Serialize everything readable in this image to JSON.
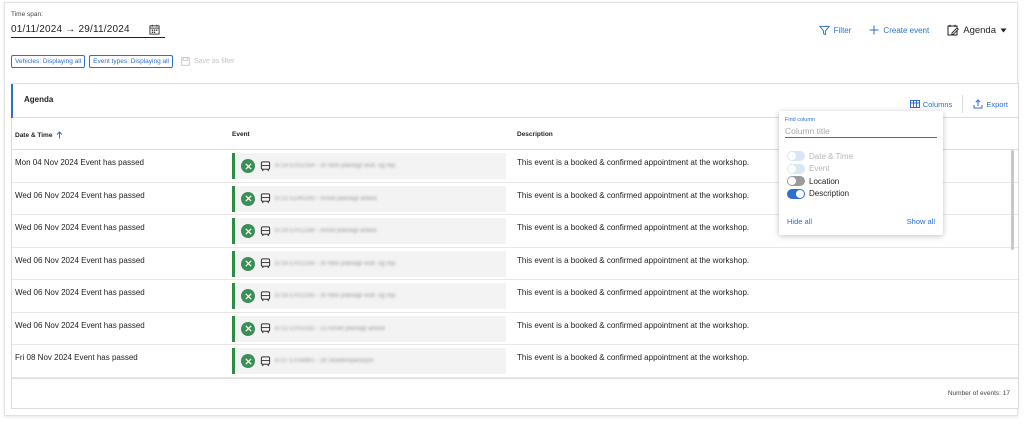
{
  "header": {
    "timespan_label": "Time span:",
    "timespan_value": "01/11/2024 → 29/11/2024",
    "calendar_icon": "calendar-icon"
  },
  "toolbar": {
    "filter_label": "Filter",
    "create_event_label": "Create event",
    "view_label": "Agenda"
  },
  "chips": {
    "vehicles": "Vehicles: Displaying all",
    "event_types": "Event types: Displaying all",
    "save_as_filter": "Save as filter"
  },
  "panel": {
    "title": "Agenda",
    "columns_label": "Columns",
    "export_label": "Export"
  },
  "table": {
    "headers": {
      "date_time": "Date & Time",
      "event": "Event",
      "description": "Description"
    },
    "rows": [
      {
        "date": "Mon 04 Nov 2024 Event has passed",
        "event": "8724 EV52164 - 30 Ikke planlagt vedl. og rep.",
        "description": "This event is a booked & confirmed appointment at the workshop."
      },
      {
        "date": "Wed 06 Nov 2024 Event has passed",
        "event": "8722 ED40260 - Annet planlagt arbeid",
        "description": "This event is a booked & confirmed appointment at the workshop."
      },
      {
        "date": "Wed 06 Nov 2024 Event has passed",
        "event": "8729 EV52189 - Annet planlagt arbeid",
        "description": "This event is a booked & confirmed appointment at the workshop."
      },
      {
        "date": "Wed 06 Nov 2024 Event has passed",
        "event": "8734 EV52164 - 30 Ikke planlagt vedl. og rep.",
        "description": "This event is a booked & confirmed appointment at the workshop."
      },
      {
        "date": "Wed 06 Nov 2024 Event has passed",
        "event": "8728 EV52165 - 30 Ikke planlagt vedl. og rep.",
        "description": "This event is a booked & confirmed appointment at the workshop."
      },
      {
        "date": "Wed 06 Nov 2024 Event has passed",
        "event": "8722 EV53182 - 13 Annet planlagt arbeid",
        "description": "This event is a booked & confirmed appointment at the workshop."
      },
      {
        "date": "Fri 08 Nov 2024 Event has passed",
        "event": "8737 EV58881 - 26 Skadereparasjon",
        "description": "This event is a booked & confirmed appointment at the workshop."
      }
    ]
  },
  "footer": {
    "count_text": "Number of events: 17"
  },
  "columns_popup": {
    "find_label": "Find column",
    "find_placeholder": "Column title",
    "options": [
      {
        "label": "Date & Time",
        "state": "disabled-on"
      },
      {
        "label": "Event",
        "state": "disabled-on"
      },
      {
        "label": "Location",
        "state": "off"
      },
      {
        "label": "Description",
        "state": "on"
      }
    ],
    "hide_all": "Hide all",
    "show_all": "Show all"
  },
  "colors": {
    "accent": "#2c6fd1",
    "event_green": "#3a8f55"
  }
}
